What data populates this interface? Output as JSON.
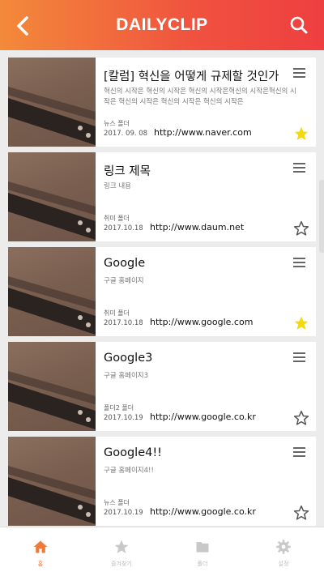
{
  "header": {
    "title": "DAILYCLIP"
  },
  "items": [
    {
      "title": "[칼럼] 혁신을 어떻게 규제할 것인가",
      "desc": "혁신의 시작은 혁신의 시작은 혁신의 시작은혁신의 시작은혁신의 시작은 혁신의 시작은 혁신의 시작은 혁신의 시작은",
      "folder": "뉴스 폴더",
      "date": "2017. 09. 08",
      "url": "http://www.naver.com",
      "starred": true
    },
    {
      "title": "링크 제목",
      "desc": "링크 내용",
      "folder": "취미 폴더",
      "date": "2017.10.18",
      "url": "http://www.daum.net",
      "starred": false
    },
    {
      "title": "Google",
      "desc": "구글 홈페이지",
      "folder": "취미 폴더",
      "date": "2017.10.18",
      "url": "http://www.google.com",
      "starred": true
    },
    {
      "title": "Google3",
      "desc": "구글 홈페이지3",
      "folder": "폴더2 폴더",
      "date": "2017.10.19",
      "url": "http://www.google.co.kr",
      "starred": false
    },
    {
      "title": "Google4!!",
      "desc": "구글 홈페이지4!!",
      "folder": "뉴스 폴더",
      "date": "2017.10.19",
      "url": "http://www.google.co.kr",
      "starred": false
    }
  ],
  "tabs": [
    {
      "label": "홈",
      "icon": "home-icon",
      "active": true
    },
    {
      "label": "즐겨찾기",
      "icon": "star-icon",
      "active": false
    },
    {
      "label": "폴더",
      "icon": "folder-icon",
      "active": false
    },
    {
      "label": "설정",
      "icon": "gear-icon",
      "active": false
    }
  ],
  "colors": {
    "accent": "#f07a3a",
    "star": "#f5d90a",
    "inactive": "#c8c8c8"
  }
}
